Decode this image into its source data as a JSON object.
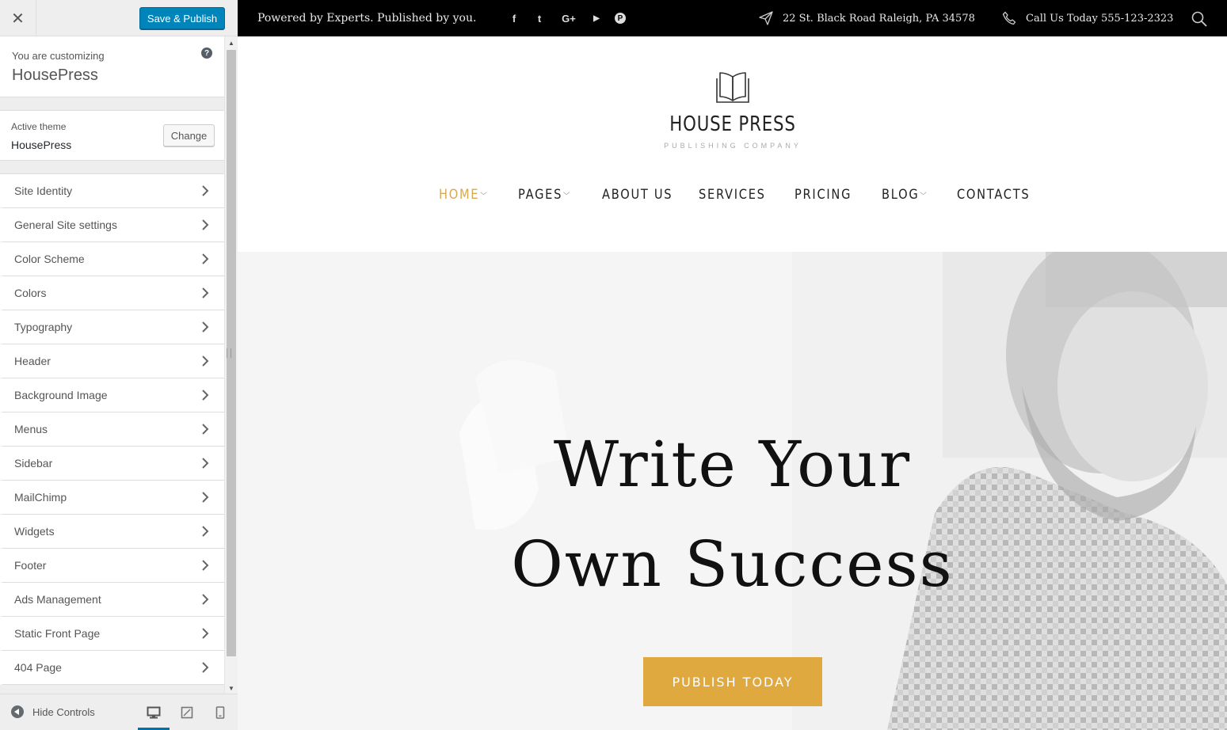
{
  "customizer": {
    "close_label": "✕",
    "save_label": "Save & Publish",
    "info": {
      "label": "You are customizing",
      "title": "HousePress",
      "help": "?"
    },
    "theme": {
      "label": "Active theme",
      "name": "HousePress",
      "change_label": "Change"
    },
    "sections": [
      {
        "label": "Site Identity"
      },
      {
        "label": "General Site settings"
      },
      {
        "label": "Color Scheme"
      },
      {
        "label": "Colors"
      },
      {
        "label": "Typography"
      },
      {
        "label": "Header"
      },
      {
        "label": "Background Image"
      },
      {
        "label": "Menus"
      },
      {
        "label": "Sidebar"
      },
      {
        "label": "MailChimp"
      },
      {
        "label": "Widgets"
      },
      {
        "label": "Footer"
      },
      {
        "label": "Ads Management"
      },
      {
        "label": "Static Front Page"
      },
      {
        "label": "404 Page"
      }
    ],
    "footer": {
      "hide_label": "Hide Controls",
      "active_device": "desktop"
    }
  },
  "preview": {
    "topbar": {
      "tagline": "Powered by Experts. Published by you.",
      "social": [
        "facebook-icon",
        "twitter-icon",
        "google-plus-icon",
        "youtube-icon",
        "pinterest-icon"
      ],
      "social_glyphs": {
        "facebook": "f",
        "twitter": "t",
        "google": "G+",
        "youtube": "▶",
        "pinterest": "P"
      },
      "address": "22 St. Black Road  Raleigh, PA 34578",
      "phone": "Call Us Today 555-123-2323"
    },
    "logo": {
      "title": "HOUSE PRESS",
      "subtitle": "PUBLISHING COMPANY"
    },
    "nav": [
      {
        "label": "HOME",
        "active": true,
        "dropdown": true
      },
      {
        "label": "PAGES",
        "active": false,
        "dropdown": true
      },
      {
        "label": "ABOUT US",
        "active": false,
        "dropdown": false
      },
      {
        "label": "SERVICES",
        "active": false,
        "dropdown": false
      },
      {
        "label": "PRICING",
        "active": false,
        "dropdown": false
      },
      {
        "label": "BLOG",
        "active": false,
        "dropdown": true
      },
      {
        "label": "CONTACTS",
        "active": false,
        "dropdown": false
      }
    ],
    "caret_glyph": "﹀",
    "hero": {
      "line1": "Write Your",
      "line2": "Own Success",
      "cta_label": "PUBLISH TODAY"
    }
  },
  "colors": {
    "primary_button": "#0085ba",
    "accent": "#d8a84e",
    "cta": "#e0a93f",
    "topbar": "#000000"
  }
}
